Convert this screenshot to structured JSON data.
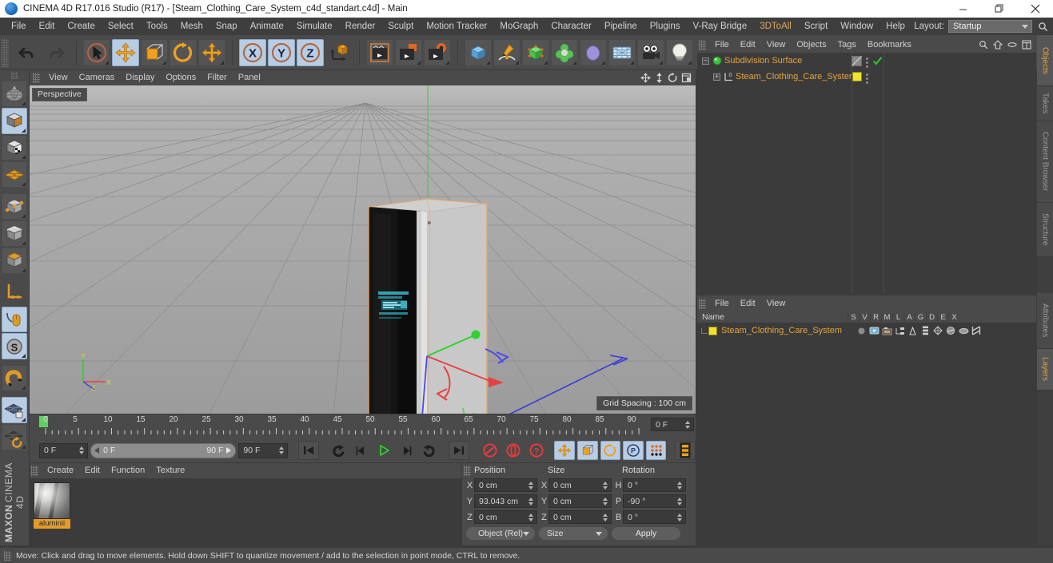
{
  "window": {
    "title": "CINEMA 4D R17.016 Studio (R17) - [Steam_Clothing_Care_System_c4d_standart.c4d] - Main",
    "app_icon": "c4d-app-icon",
    "minimize": "–",
    "maximize": "❐",
    "close": "✕"
  },
  "menubar": {
    "items": [
      {
        "label": "File"
      },
      {
        "label": "Edit"
      },
      {
        "label": "Create"
      },
      {
        "label": "Select"
      },
      {
        "label": "Tools"
      },
      {
        "label": "Mesh"
      },
      {
        "label": "Snap"
      },
      {
        "label": "Animate"
      },
      {
        "label": "Simulate"
      },
      {
        "label": "Render"
      },
      {
        "label": "Sculpt"
      },
      {
        "label": "Motion Tracker"
      },
      {
        "label": "MoGraph"
      },
      {
        "label": "Character"
      },
      {
        "label": "Pipeline"
      },
      {
        "label": "Plugins"
      },
      {
        "label": "V-Ray Bridge"
      },
      {
        "label": "3DToAll"
      },
      {
        "label": "Script"
      },
      {
        "label": "Window"
      },
      {
        "label": "Help"
      }
    ],
    "layout_label": "Layout:",
    "layout_value": "Startup",
    "search_icon": "search-icon"
  },
  "toolbar": {
    "buttons": [
      {
        "name": "undo-button",
        "icon": "undo-arrow-icon",
        "selected": false
      },
      {
        "name": "redo-button",
        "icon": "redo-arrow-icon",
        "selected": false
      },
      {
        "name": "live-selection-button",
        "icon": "cursor-circle-icon",
        "selected": false
      },
      {
        "name": "move-button",
        "icon": "move-cross-icon",
        "selected": true
      },
      {
        "name": "scale-button",
        "icon": "scale-box-icon",
        "selected": false
      },
      {
        "name": "rotate-button",
        "icon": "rotate-circle-icon",
        "selected": false
      },
      {
        "name": "move-alt-button",
        "icon": "move-cross-icon",
        "selected": false
      },
      {
        "name": "axis-x-button",
        "icon": "x-axis-icon",
        "selected": true
      },
      {
        "name": "axis-y-button",
        "icon": "y-axis-icon",
        "selected": true
      },
      {
        "name": "axis-z-button",
        "icon": "z-axis-icon",
        "selected": true
      },
      {
        "name": "world-object-coord-button",
        "icon": "world-axis-cube-icon",
        "selected": false
      },
      {
        "name": "render-view-button",
        "icon": "clapper-icon",
        "selected": false
      },
      {
        "name": "render-region-button",
        "icon": "clapper-region-icon",
        "selected": false
      },
      {
        "name": "render-settings-button",
        "icon": "clapper-gear-icon",
        "selected": false
      },
      {
        "name": "add-cube-button",
        "icon": "cube-blue-icon",
        "selected": false
      },
      {
        "name": "add-spline-button",
        "icon": "pen-spline-icon",
        "selected": false
      },
      {
        "name": "add-nurbs-button",
        "icon": "green-cube-icon",
        "selected": false
      },
      {
        "name": "add-modeling-object-button",
        "icon": "green-clover-icon",
        "selected": false
      },
      {
        "name": "add-deformer-button",
        "icon": "bend-deformer-icon",
        "selected": false
      },
      {
        "name": "add-environment-button",
        "icon": "floor-grid-icon",
        "selected": false
      },
      {
        "name": "add-camera-button",
        "icon": "camera-icon",
        "selected": false
      },
      {
        "name": "add-light-button",
        "icon": "light-bulb-icon",
        "selected": false
      }
    ]
  },
  "left_toolbar": {
    "buttons": [
      {
        "name": "model-mode-button",
        "icon": "globe-wire-icon",
        "selected": false
      },
      {
        "name": "object-mode-button",
        "icon": "orange-cube-icon",
        "selected": true
      },
      {
        "name": "texture-mode-button",
        "icon": "checker-cube-icon",
        "selected": false
      },
      {
        "name": "workplane-mode-button",
        "icon": "orange-grid-diamond-icon",
        "selected": false
      },
      {
        "name": "points-mode-button",
        "icon": "cube-points-icon",
        "selected": false
      },
      {
        "name": "edges-mode-button",
        "icon": "cube-edges-icon",
        "selected": false
      },
      {
        "name": "polygons-mode-button",
        "icon": "cube-polygon-icon",
        "selected": false
      },
      {
        "name": "enable-axis-button",
        "icon": "axis-l-icon",
        "selected": false
      },
      {
        "name": "viewport-solo-button",
        "icon": "mouse-orange-icon",
        "selected": true
      },
      {
        "name": "scale-snap-button",
        "icon": "s-circle-icon",
        "selected": true
      },
      {
        "name": "magnet-button",
        "icon": "magnet-icon",
        "selected": false
      },
      {
        "name": "workplane-lock-button",
        "icon": "grid-lock-icon",
        "selected": true
      },
      {
        "name": "workplane-rotate-button",
        "icon": "grid-rotate-icon",
        "selected": false
      }
    ],
    "brand_bold": "MAXON",
    "brand_thin": "CINEMA 4D"
  },
  "viewport": {
    "menus": [
      {
        "label": "View"
      },
      {
        "label": "Cameras"
      },
      {
        "label": "Display"
      },
      {
        "label": "Options"
      },
      {
        "label": "Filter"
      },
      {
        "label": "Panel"
      }
    ],
    "corner_icons": [
      {
        "name": "pan-viewport-icon"
      },
      {
        "name": "dolly-viewport-icon"
      },
      {
        "name": "rotate-viewport-icon"
      },
      {
        "name": "maximize-viewport-icon"
      }
    ],
    "label": "Perspective",
    "grid_spacing": "Grid Spacing : 100 cm",
    "axis_labels": {
      "y": "Y",
      "x": "X",
      "z": "Z"
    }
  },
  "timeline": {
    "ruler_ticks": [
      0,
      5,
      10,
      15,
      20,
      25,
      30,
      35,
      40,
      45,
      50,
      55,
      60,
      65,
      70,
      75,
      80,
      85,
      90
    ],
    "current_frame_field": "0 F",
    "start_frame": "0 F",
    "range_start": "0 F",
    "range_end": "90 F",
    "end_frame": "90 F",
    "controls": [
      {
        "name": "go-to-start-button",
        "icon": "skip-start-icon",
        "selected": false
      },
      {
        "name": "go-to-prev-key-button",
        "icon": "prev-key-icon",
        "selected": false
      },
      {
        "name": "step-back-button",
        "icon": "step-back-icon",
        "selected": false
      },
      {
        "name": "play-button",
        "icon": "play-icon",
        "selected": false
      },
      {
        "name": "step-forward-button",
        "icon": "step-forward-icon",
        "selected": false
      },
      {
        "name": "go-to-next-key-button",
        "icon": "next-key-icon",
        "selected": false
      },
      {
        "name": "go-to-end-button",
        "icon": "skip-end-icon",
        "selected": false
      },
      {
        "name": "record-active-objects-button",
        "icon": "record-red-icon",
        "selected": false
      },
      {
        "name": "autokeying-button",
        "icon": "autokey-red-icon",
        "selected": false
      },
      {
        "name": "keyframe-selection-button",
        "icon": "question-red-icon",
        "selected": false
      },
      {
        "name": "position-key-button",
        "icon": "move-cross-icon",
        "selected": true
      },
      {
        "name": "scale-key-button",
        "icon": "scale-box-icon",
        "selected": true
      },
      {
        "name": "rotation-key-button",
        "icon": "rotate-circle-icon",
        "selected": true
      },
      {
        "name": "parameter-key-button",
        "icon": "p-circle-icon",
        "selected": true
      },
      {
        "name": "point-level-animation-button",
        "icon": "pla-dots-icon",
        "selected": true
      },
      {
        "name": "keyframe-mode-button",
        "icon": "keyframe-strip-icon",
        "selected": false
      }
    ]
  },
  "material_manager": {
    "menus": [
      {
        "label": "Create"
      },
      {
        "label": "Edit"
      },
      {
        "label": "Function"
      },
      {
        "label": "Texture"
      }
    ],
    "materials": [
      {
        "name": "aluminii",
        "preview": "aluminium-sphere-preview"
      }
    ]
  },
  "coordinates": {
    "headers": {
      "position": "Position",
      "size": "Size",
      "rotation": "Rotation"
    },
    "rows": [
      {
        "pos_axis": "X",
        "pos_value": "0 cm",
        "size_axis": "X",
        "size_value": "0 cm",
        "rot_axis": "H",
        "rot_value": "0 °"
      },
      {
        "pos_axis": "Y",
        "pos_value": "93.043 cm",
        "size_axis": "Y",
        "size_value": "0 cm",
        "rot_axis": "P",
        "rot_value": "-90 °"
      },
      {
        "pos_axis": "Z",
        "pos_value": "0 cm",
        "size_axis": "Z",
        "size_value": "0 cm",
        "rot_axis": "B",
        "rot_value": "0 °"
      }
    ],
    "mode_dropdown": "Object (Rel)",
    "size_dropdown": "Size",
    "apply_button": "Apply"
  },
  "object_manager": {
    "menus": [
      {
        "label": "File"
      },
      {
        "label": "Edit"
      },
      {
        "label": "View"
      },
      {
        "label": "Objects"
      },
      {
        "label": "Tags"
      },
      {
        "label": "Bookmarks"
      }
    ],
    "corner_icons": [
      {
        "name": "search-icon"
      },
      {
        "name": "go-up-home-icon"
      },
      {
        "name": "filter-oval-icon"
      },
      {
        "name": "layout-columns-icon"
      }
    ],
    "rows": [
      {
        "label": "Subdivision Surface",
        "icon": "subdivision-surface-icon",
        "indent": 0,
        "tag": "checkmark-green-icon",
        "swatch": null
      },
      {
        "label": "Steam_Clothing_Care_System",
        "icon": "null-object-icon",
        "indent": 1,
        "tag": null,
        "swatch": "#f0e32f"
      }
    ]
  },
  "layer_manager": {
    "menus": [
      {
        "label": "File"
      },
      {
        "label": "Edit"
      },
      {
        "label": "View"
      }
    ],
    "columns": [
      "Name",
      "S",
      "V",
      "R",
      "M",
      "L",
      "A",
      "G",
      "D",
      "E",
      "X"
    ],
    "rows": [
      {
        "name": "Steam_Clothing_Care_System",
        "swatch": "#f0e32f",
        "icons": [
          "solo-dot-icon",
          "view-screen-icon",
          "render-camera-icon",
          "manager-icon",
          "lock-icon",
          "animation-icon",
          "generators-icon",
          "deformers-icon",
          "expressions-icon",
          "xref-icon"
        ]
      }
    ]
  },
  "right_tabs": [
    {
      "label": "Objects",
      "active": true
    },
    {
      "label": "Takes",
      "active": false
    },
    {
      "label": "Content Browser",
      "active": false
    },
    {
      "label": "Structure",
      "active": false
    },
    {
      "label": "Attributes",
      "active": false
    },
    {
      "label": "Layers",
      "active": true
    }
  ],
  "statusbar": {
    "message": "Move: Click and drag to move elements. Hold down SHIFT to quantize movement / add to the selection in point mode, CTRL to remove."
  },
  "colors": {
    "accent_orange": "#e5a33c",
    "selection_blue": "#b8cde4",
    "panel_bg": "#4a4a4a",
    "list_bg": "#3b3b3b",
    "axis_x": "#e03c3c",
    "axis_y": "#3ccc3c",
    "axis_z": "#3c3ce0",
    "swatch_yellow": "#f0e32f"
  }
}
